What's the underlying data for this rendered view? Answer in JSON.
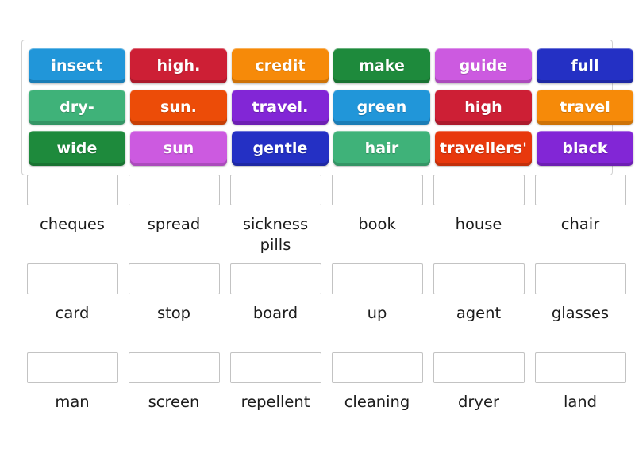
{
  "activity": {
    "type": "match-up-word-tiles",
    "tile_bank": {
      "rows": [
        [
          {
            "label": "insect",
            "color": "#2196d9"
          },
          {
            "label": "high.",
            "color": "#cd1f35"
          },
          {
            "label": "credit",
            "color": "#f68a09"
          },
          {
            "label": "make",
            "color": "#1e8a3c"
          },
          {
            "label": "guide",
            "color": "#cc5ae0"
          },
          {
            "label": "full",
            "color": "#2430c4"
          }
        ],
        [
          {
            "label": "dry-",
            "color": "#3fb279"
          },
          {
            "label": "sun.",
            "color": "#ec4c08"
          },
          {
            "label": "travel.",
            "color": "#8226d6"
          },
          {
            "label": "green",
            "color": "#2196d9"
          },
          {
            "label": "high",
            "color": "#cd1f35"
          },
          {
            "label": "travel",
            "color": "#f68a09"
          }
        ],
        [
          {
            "label": "wide",
            "color": "#1e8a3c"
          },
          {
            "label": "sun",
            "color": "#cc5ae0"
          },
          {
            "label": "gentle",
            "color": "#2430c4"
          },
          {
            "label": "hair",
            "color": "#3fb279"
          },
          {
            "label": "travellers'",
            "color": "#e8380d"
          },
          {
            "label": "black",
            "color": "#8226d6"
          }
        ]
      ]
    },
    "answer_grid": {
      "rows": [
        [
          {
            "prompt": "cheques",
            "answer": ""
          },
          {
            "prompt": "spread",
            "answer": ""
          },
          {
            "prompt": "sickness pills",
            "answer": ""
          },
          {
            "prompt": "book",
            "answer": ""
          },
          {
            "prompt": "house",
            "answer": ""
          },
          {
            "prompt": "chair",
            "answer": ""
          }
        ],
        [
          {
            "prompt": "card",
            "answer": ""
          },
          {
            "prompt": "stop",
            "answer": ""
          },
          {
            "prompt": "board",
            "answer": ""
          },
          {
            "prompt": "up",
            "answer": ""
          },
          {
            "prompt": "agent",
            "answer": ""
          },
          {
            "prompt": "glasses",
            "answer": ""
          }
        ],
        [
          {
            "prompt": "man",
            "answer": ""
          },
          {
            "prompt": "screen",
            "answer": ""
          },
          {
            "prompt": "repellent",
            "answer": ""
          },
          {
            "prompt": "cleaning",
            "answer": ""
          },
          {
            "prompt": "dryer",
            "answer": ""
          },
          {
            "prompt": "land",
            "answer": ""
          }
        ]
      ]
    }
  },
  "theme": {
    "page_background": "#ffffff",
    "container_border": "#d2d2d2",
    "dropzone_border": "#c3c3c3",
    "prompt_text": "#1c1c1c",
    "tile_text": "#ffffff"
  }
}
